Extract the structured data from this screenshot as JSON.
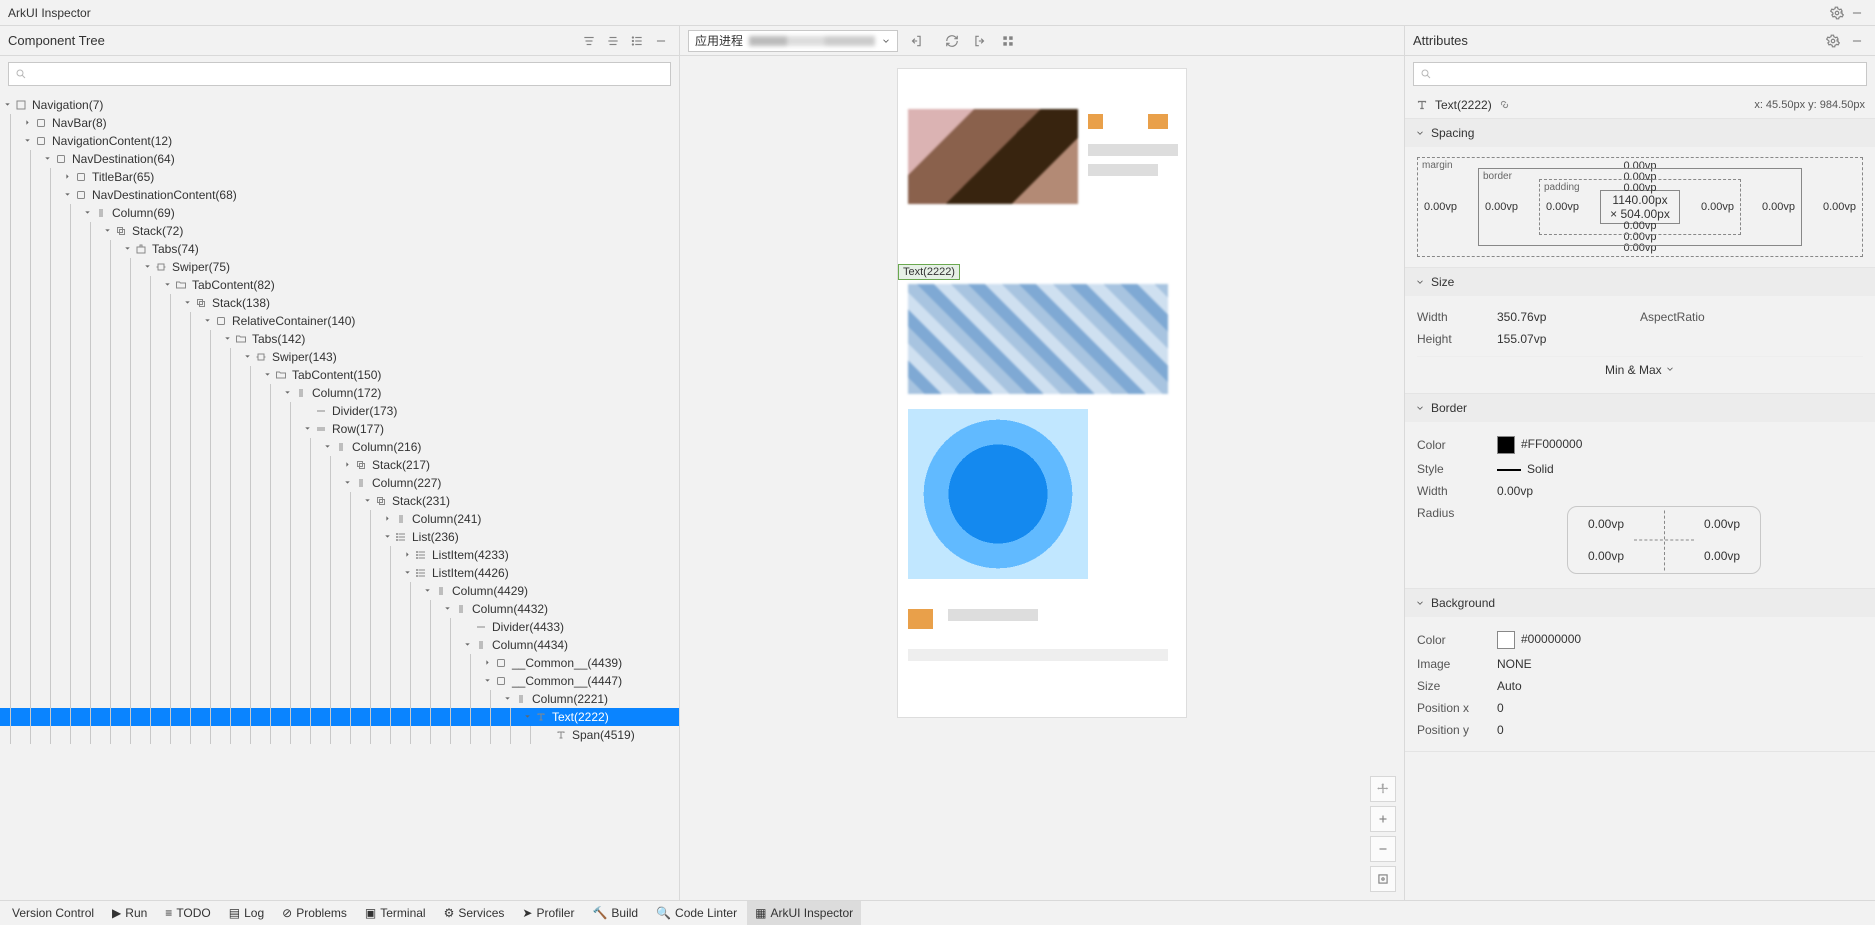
{
  "title": "ArkUI Inspector",
  "leftPanel": {
    "title": "Component Tree"
  },
  "midPanel": {
    "processLabel": "应用进程"
  },
  "rightPanel": {
    "title": "Attributes"
  },
  "selected": {
    "type": "Text(2222)",
    "coords": "x: 45.50px  y: 984.50px",
    "hoverLabel": "Text(2222)"
  },
  "tree": [
    {
      "d": 0,
      "e": 1,
      "t": "cont",
      "l": "Navigation(7)"
    },
    {
      "d": 1,
      "e": 0,
      "t": "comp",
      "l": "NavBar(8)"
    },
    {
      "d": 1,
      "e": 1,
      "t": "comp",
      "l": "NavigationContent(12)"
    },
    {
      "d": 2,
      "e": 1,
      "t": "comp",
      "l": "NavDestination(64)"
    },
    {
      "d": 3,
      "e": 0,
      "t": "comp",
      "l": "TitleBar(65)"
    },
    {
      "d": 3,
      "e": 1,
      "t": "comp",
      "l": "NavDestinationContent(68)"
    },
    {
      "d": 4,
      "e": 1,
      "t": "col",
      "l": "Column(69)"
    },
    {
      "d": 5,
      "e": 1,
      "t": "stack",
      "l": "Stack(72)"
    },
    {
      "d": 6,
      "e": 1,
      "t": "tabs",
      "l": "Tabs(74)"
    },
    {
      "d": 7,
      "e": 1,
      "t": "swiper",
      "l": "Swiper(75)"
    },
    {
      "d": 8,
      "e": 1,
      "t": "folder",
      "l": "TabContent(82)"
    },
    {
      "d": 9,
      "e": 1,
      "t": "stack",
      "l": "Stack(138)"
    },
    {
      "d": 10,
      "e": 1,
      "t": "comp",
      "l": "RelativeContainer(140)"
    },
    {
      "d": 11,
      "e": 1,
      "t": "folder",
      "l": "Tabs(142)"
    },
    {
      "d": 12,
      "e": 1,
      "t": "swiper",
      "l": "Swiper(143)"
    },
    {
      "d": 13,
      "e": 1,
      "t": "folder",
      "l": "TabContent(150)"
    },
    {
      "d": 14,
      "e": 1,
      "t": "col",
      "l": "Column(172)"
    },
    {
      "d": 15,
      "e": null,
      "t": "div",
      "l": "Divider(173)"
    },
    {
      "d": 15,
      "e": 1,
      "t": "row",
      "l": "Row(177)"
    },
    {
      "d": 16,
      "e": 1,
      "t": "col",
      "l": "Column(216)"
    },
    {
      "d": 17,
      "e": 0,
      "t": "stack",
      "l": "Stack(217)"
    },
    {
      "d": 17,
      "e": 1,
      "t": "col",
      "l": "Column(227)"
    },
    {
      "d": 18,
      "e": 1,
      "t": "stack",
      "l": "Stack(231)"
    },
    {
      "d": 19,
      "e": 0,
      "t": "col",
      "l": "Column(241)"
    },
    {
      "d": 19,
      "e": 1,
      "t": "list",
      "l": "List(236)"
    },
    {
      "d": 20,
      "e": 0,
      "t": "list",
      "l": "ListItem(4233)"
    },
    {
      "d": 20,
      "e": 1,
      "t": "list",
      "l": "ListItem(4426)"
    },
    {
      "d": 21,
      "e": 1,
      "t": "col",
      "l": "Column(4429)"
    },
    {
      "d": 22,
      "e": 1,
      "t": "col",
      "l": "Column(4432)"
    },
    {
      "d": 23,
      "e": null,
      "t": "div",
      "l": "Divider(4433)"
    },
    {
      "d": 23,
      "e": 1,
      "t": "col",
      "l": "Column(4434)"
    },
    {
      "d": 24,
      "e": 0,
      "t": "comp",
      "l": "__Common__(4439)"
    },
    {
      "d": 24,
      "e": 1,
      "t": "comp",
      "l": "__Common__(4447)"
    },
    {
      "d": 25,
      "e": 1,
      "t": "col",
      "l": "Column(2221)"
    },
    {
      "d": 26,
      "e": 1,
      "t": "text",
      "l": "Text(2222)",
      "sel": true
    },
    {
      "d": 27,
      "e": null,
      "t": "text",
      "l": "Span(4519)"
    }
  ],
  "spacing": {
    "section": "Spacing",
    "margin": {
      "label": "margin",
      "t": "0.00vp",
      "r": "0.00vp",
      "b": "0.00vp",
      "l": "0.00vp"
    },
    "border": {
      "label": "border",
      "t": "0.00vp",
      "r": "0.00vp",
      "b": "0.00vp",
      "l": "0.00vp"
    },
    "padding": {
      "label": "padding",
      "t": "0.00vp",
      "r": "0.00vp",
      "b": "0.00vp",
      "l": "0.00vp"
    },
    "content": "1140.00px × 504.00px"
  },
  "size": {
    "section": "Size",
    "widthK": "Width",
    "widthV": "350.76vp",
    "heightK": "Height",
    "heightV": "155.07vp",
    "aspectK": "AspectRatio",
    "aspectV": "",
    "minmax": "Min & Max"
  },
  "border": {
    "section": "Border",
    "colorK": "Color",
    "colorV": "#FF000000",
    "styleK": "Style",
    "styleV": "Solid",
    "widthK": "Width",
    "widthV": "0.00vp",
    "radiusK": "Radius",
    "rTL": "0.00vp",
    "rTR": "0.00vp",
    "rBL": "0.00vp",
    "rBR": "0.00vp"
  },
  "background": {
    "section": "Background",
    "colorK": "Color",
    "colorV": "#00000000",
    "imageK": "Image",
    "imageV": "NONE",
    "sizeK": "Size",
    "sizeV": "Auto",
    "posXK": "Position x",
    "posXV": "0",
    "posYK": "Position y",
    "posYV": "0"
  },
  "bottomTabs": [
    {
      "l": "Version Control"
    },
    {
      "l": "Run",
      "i": "play"
    },
    {
      "l": "TODO",
      "i": "list"
    },
    {
      "l": "Log",
      "i": "log"
    },
    {
      "l": "Problems",
      "i": "warn"
    },
    {
      "l": "Terminal",
      "i": "term"
    },
    {
      "l": "Services",
      "i": "cog"
    },
    {
      "l": "Profiler",
      "i": "send"
    },
    {
      "l": "Build",
      "i": "hammer"
    },
    {
      "l": "Code Linter",
      "i": "search"
    },
    {
      "l": "ArkUI Inspector",
      "i": "layers",
      "active": true
    }
  ]
}
